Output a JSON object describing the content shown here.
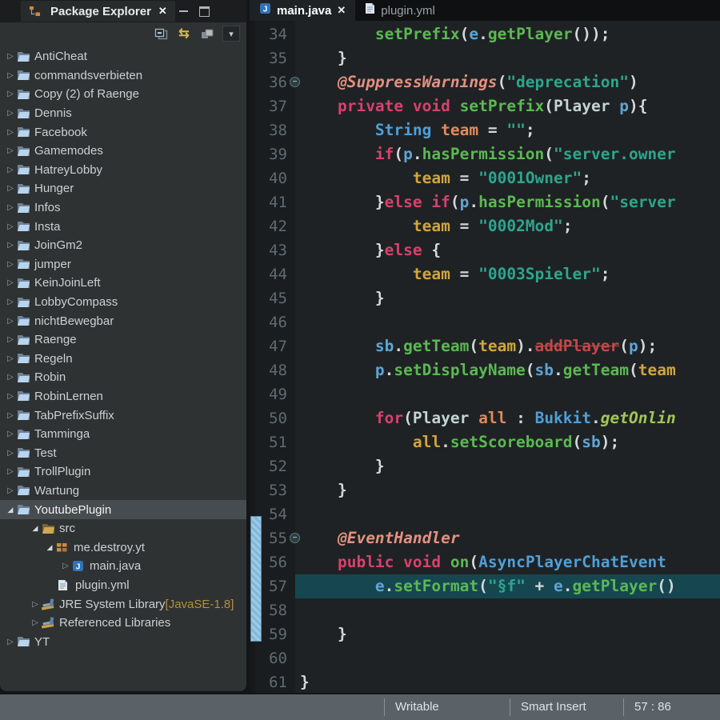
{
  "package_explorer": {
    "title": "Package Explorer",
    "toolbar": {
      "collapse_all": "collapse-all",
      "link_with_editor": "link-with-editor",
      "view_options": "view-options",
      "view_menu": "view-menu"
    },
    "tree": [
      {
        "label": "AntiCheat",
        "pad": 5,
        "arrow": "collapsed",
        "icon": "project-folder"
      },
      {
        "label": "commandsverbieten",
        "pad": 5,
        "arrow": "collapsed",
        "icon": "project-folder"
      },
      {
        "label": "Copy (2) of Raenge",
        "pad": 5,
        "arrow": "collapsed",
        "icon": "project-folder"
      },
      {
        "label": "Dennis",
        "pad": 5,
        "arrow": "collapsed",
        "icon": "project-folder"
      },
      {
        "label": "Facebook",
        "pad": 5,
        "arrow": "collapsed",
        "icon": "project-folder"
      },
      {
        "label": "Gamemodes",
        "pad": 5,
        "arrow": "collapsed",
        "icon": "project-folder"
      },
      {
        "label": "HatreyLobby",
        "pad": 5,
        "arrow": "collapsed",
        "icon": "project-folder"
      },
      {
        "label": "Hunger",
        "pad": 5,
        "arrow": "collapsed",
        "icon": "project-folder"
      },
      {
        "label": "Infos",
        "pad": 5,
        "arrow": "collapsed",
        "icon": "project-folder"
      },
      {
        "label": "Insta",
        "pad": 5,
        "arrow": "collapsed",
        "icon": "project-folder"
      },
      {
        "label": "JoinGm2",
        "pad": 5,
        "arrow": "collapsed",
        "icon": "project-folder"
      },
      {
        "label": "jumper",
        "pad": 5,
        "arrow": "collapsed",
        "icon": "project-folder"
      },
      {
        "label": "KeinJoinLeft",
        "pad": 5,
        "arrow": "collapsed",
        "icon": "project-folder"
      },
      {
        "label": "LobbyCompass",
        "pad": 5,
        "arrow": "collapsed",
        "icon": "project-folder"
      },
      {
        "label": "nichtBewegbar",
        "pad": 5,
        "arrow": "collapsed",
        "icon": "project-folder"
      },
      {
        "label": "Raenge",
        "pad": 5,
        "arrow": "collapsed",
        "icon": "project-folder"
      },
      {
        "label": "Regeln",
        "pad": 5,
        "arrow": "collapsed",
        "icon": "project-folder"
      },
      {
        "label": "Robin",
        "pad": 5,
        "arrow": "collapsed",
        "icon": "project-folder"
      },
      {
        "label": "RobinLernen",
        "pad": 5,
        "arrow": "collapsed",
        "icon": "project-folder"
      },
      {
        "label": "TabPrefixSuffix",
        "pad": 5,
        "arrow": "collapsed",
        "icon": "project-folder"
      },
      {
        "label": "Tamminga",
        "pad": 5,
        "arrow": "collapsed",
        "icon": "project-folder"
      },
      {
        "label": "Test",
        "pad": 5,
        "arrow": "collapsed",
        "icon": "project-folder"
      },
      {
        "label": "TrollPlugin",
        "pad": 5,
        "arrow": "collapsed",
        "icon": "project-folder"
      },
      {
        "label": "Wartung",
        "pad": 5,
        "arrow": "collapsed",
        "icon": "project-folder"
      },
      {
        "label": "YoutubePlugin",
        "pad": 5,
        "arrow": "expanded",
        "icon": "project-folder",
        "selected": true
      },
      {
        "label": "src",
        "pad": 36,
        "arrow": "expanded",
        "icon": "src-folder"
      },
      {
        "label": "me.destroy.yt",
        "pad": 54,
        "arrow": "expanded",
        "icon": "package"
      },
      {
        "label": "main.java",
        "pad": 74,
        "arrow": "collapsed",
        "icon": "java-file"
      },
      {
        "label": "plugin.yml",
        "pad": 72,
        "arrow": "none",
        "icon": "yml-file"
      },
      {
        "label": "JRE System Library",
        "suffix": " [JavaSE-1.8]",
        "pad": 36,
        "arrow": "collapsed",
        "icon": "library"
      },
      {
        "label": "Referenced Libraries",
        "pad": 36,
        "arrow": "collapsed",
        "icon": "library"
      },
      {
        "label": "YT",
        "pad": 5,
        "arrow": "collapsed",
        "icon": "project-folder"
      }
    ]
  },
  "editor": {
    "tabs": [
      {
        "label": "main.java",
        "icon": "java-file",
        "active": true,
        "closable": true
      },
      {
        "label": "plugin.yml",
        "icon": "yml-file",
        "active": false
      }
    ],
    "lines": [
      {
        "n": 34,
        "t": [
          [
            "        ",
            "pl"
          ],
          [
            "setPrefix",
            "meth"
          ],
          [
            "(",
            "pl"
          ],
          [
            "e",
            "var"
          ],
          [
            ".",
            "pl"
          ],
          [
            "getPlayer",
            "meth"
          ],
          [
            "());",
            "pl"
          ]
        ]
      },
      {
        "n": 35,
        "t": [
          [
            "    }",
            "pl"
          ]
        ]
      },
      {
        "n": 36,
        "fold": true,
        "t": [
          [
            "    ",
            "pl"
          ],
          [
            "@SuppressWarnings",
            "ann"
          ],
          [
            "(",
            "pl"
          ],
          [
            "\"deprecation\"",
            "str"
          ],
          [
            ")",
            "pl"
          ]
        ]
      },
      {
        "n": 37,
        "t": [
          [
            "    ",
            "pl"
          ],
          [
            "private",
            "kw"
          ],
          [
            " ",
            "pl"
          ],
          [
            "void",
            "kw"
          ],
          [
            " ",
            "pl"
          ],
          [
            "setPrefix",
            "meth"
          ],
          [
            "(",
            "pl"
          ],
          [
            "Player",
            "pale"
          ],
          [
            " ",
            "pl"
          ],
          [
            "p",
            "var"
          ],
          [
            "){",
            "pl"
          ]
        ]
      },
      {
        "n": 38,
        "t": [
          [
            "        ",
            "pl"
          ],
          [
            "String",
            "cls"
          ],
          [
            " ",
            "pl"
          ],
          [
            "team",
            "decl"
          ],
          [
            " = ",
            "pl"
          ],
          [
            "\"\"",
            "str"
          ],
          [
            ";",
            "pl"
          ]
        ]
      },
      {
        "n": 39,
        "t": [
          [
            "        ",
            "pl"
          ],
          [
            "if",
            "kw"
          ],
          [
            "(",
            "pl"
          ],
          [
            "p",
            "var"
          ],
          [
            ".",
            "pl"
          ],
          [
            "hasPermission",
            "meth"
          ],
          [
            "(",
            "pl"
          ],
          [
            "\"server.owner",
            "str"
          ]
        ]
      },
      {
        "n": 40,
        "t": [
          [
            "            ",
            "pl"
          ],
          [
            "team",
            "ref"
          ],
          [
            " = ",
            "pl"
          ],
          [
            "\"0001Owner\"",
            "str"
          ],
          [
            ";",
            "pl"
          ]
        ]
      },
      {
        "n": 41,
        "t": [
          [
            "        }",
            "pl"
          ],
          [
            "else",
            "kw"
          ],
          [
            " ",
            "pl"
          ],
          [
            "if",
            "kw"
          ],
          [
            "(",
            "pl"
          ],
          [
            "p",
            "var"
          ],
          [
            ".",
            "pl"
          ],
          [
            "hasPermission",
            "meth"
          ],
          [
            "(",
            "pl"
          ],
          [
            "\"server",
            "str"
          ]
        ]
      },
      {
        "n": 42,
        "t": [
          [
            "            ",
            "pl"
          ],
          [
            "team",
            "ref"
          ],
          [
            " = ",
            "pl"
          ],
          [
            "\"0002Mod\"",
            "str"
          ],
          [
            ";",
            "pl"
          ]
        ]
      },
      {
        "n": 43,
        "t": [
          [
            "        }",
            "pl"
          ],
          [
            "else",
            "kw"
          ],
          [
            " {",
            "pl"
          ]
        ]
      },
      {
        "n": 44,
        "t": [
          [
            "            ",
            "pl"
          ],
          [
            "team",
            "ref"
          ],
          [
            " = ",
            "pl"
          ],
          [
            "\"0003Spieler\"",
            "str"
          ],
          [
            ";",
            "pl"
          ]
        ]
      },
      {
        "n": 45,
        "t": [
          [
            "        }",
            "pl"
          ]
        ]
      },
      {
        "n": 46,
        "t": []
      },
      {
        "n": 47,
        "t": [
          [
            "        ",
            "pl"
          ],
          [
            "sb",
            "var"
          ],
          [
            ".",
            "pl"
          ],
          [
            "getTeam",
            "meth"
          ],
          [
            "(",
            "pl"
          ],
          [
            "team",
            "ref"
          ],
          [
            ").",
            "pl"
          ],
          [
            "addPlayer",
            "dep"
          ],
          [
            "(",
            "pl"
          ],
          [
            "p",
            "var"
          ],
          [
            ");",
            "pl"
          ]
        ]
      },
      {
        "n": 48,
        "t": [
          [
            "        ",
            "pl"
          ],
          [
            "p",
            "var"
          ],
          [
            ".",
            "pl"
          ],
          [
            "setDisplayName",
            "meth"
          ],
          [
            "(",
            "pl"
          ],
          [
            "sb",
            "var"
          ],
          [
            ".",
            "pl"
          ],
          [
            "getTeam",
            "meth"
          ],
          [
            "(",
            "pl"
          ],
          [
            "team",
            "ref"
          ]
        ]
      },
      {
        "n": 49,
        "t": []
      },
      {
        "n": 50,
        "t": [
          [
            "        ",
            "pl"
          ],
          [
            "for",
            "kw"
          ],
          [
            "(",
            "pl"
          ],
          [
            "Player",
            "pale"
          ],
          [
            " ",
            "pl"
          ],
          [
            "all",
            "decl"
          ],
          [
            " : ",
            "pl"
          ],
          [
            "Bukkit",
            "cls"
          ],
          [
            ".",
            "pl"
          ],
          [
            "getOnlin",
            "stat"
          ]
        ]
      },
      {
        "n": 51,
        "t": [
          [
            "            ",
            "pl"
          ],
          [
            "all",
            "ref"
          ],
          [
            ".",
            "pl"
          ],
          [
            "setScoreboard",
            "meth"
          ],
          [
            "(",
            "pl"
          ],
          [
            "sb",
            "var"
          ],
          [
            ");",
            "pl"
          ]
        ]
      },
      {
        "n": 52,
        "t": [
          [
            "        }",
            "pl"
          ]
        ]
      },
      {
        "n": 53,
        "t": [
          [
            "    }",
            "pl"
          ]
        ]
      },
      {
        "n": 54,
        "t": []
      },
      {
        "n": 55,
        "fold": true,
        "t": [
          [
            "    ",
            "pl"
          ],
          [
            "@EventHandler",
            "ann"
          ]
        ]
      },
      {
        "n": 56,
        "t": [
          [
            "    ",
            "pl"
          ],
          [
            "public",
            "kw"
          ],
          [
            " ",
            "pl"
          ],
          [
            "void",
            "kw"
          ],
          [
            " ",
            "pl"
          ],
          [
            "on",
            "meth"
          ],
          [
            "(",
            "pl"
          ],
          [
            "AsyncPlayerChatEvent",
            "cls"
          ],
          [
            " ",
            "pl"
          ]
        ]
      },
      {
        "n": 57,
        "hl": true,
        "t": [
          [
            "        ",
            "pl"
          ],
          [
            "e",
            "var"
          ],
          [
            ".",
            "pl"
          ],
          [
            "setFormat",
            "meth"
          ],
          [
            "(",
            "pl"
          ],
          [
            "\"§f\"",
            "str"
          ],
          [
            " + ",
            "pl"
          ],
          [
            "e",
            "var"
          ],
          [
            ".",
            "pl"
          ],
          [
            "getPlayer",
            "meth"
          ],
          [
            "()",
            "pl"
          ]
        ]
      },
      {
        "n": 58,
        "t": []
      },
      {
        "n": 59,
        "t": [
          [
            "    }",
            "pl"
          ]
        ]
      },
      {
        "n": 60,
        "t": []
      },
      {
        "n": 61,
        "t": [
          [
            "}",
            "pl"
          ]
        ]
      }
    ]
  },
  "status_bar": {
    "writable": "Writable",
    "smart_insert": "Smart Insert",
    "position": "57 : 86"
  },
  "colors": {
    "keyword": "#d8416d",
    "method": "#5cb854",
    "string": "#2da58e",
    "class": "#4f9fd6",
    "variable": "#5ea4d4",
    "declaration": "#e08a5c",
    "reference": "#cfa63c",
    "annotation": "#e29182",
    "deprecated": "#c24848",
    "static_method": "#a2c659",
    "line_highlight": "#164750",
    "editor_bg": "#1f2224",
    "panel_bg": "#2f3233",
    "status_bg": "#5a6268"
  }
}
